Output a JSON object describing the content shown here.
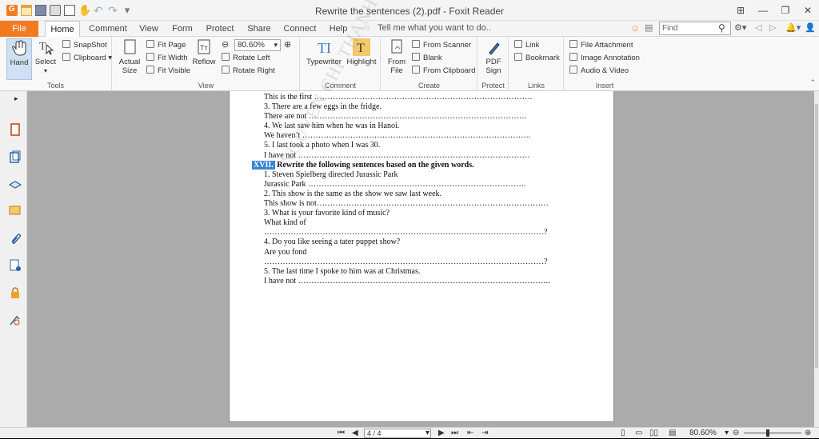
{
  "window": {
    "title": "Rewrite the sentences (2).pdf - Foxit Reader",
    "buttons": [
      "⊞",
      "—",
      "❐",
      "✕"
    ]
  },
  "menu": {
    "tabs": [
      "File",
      "Home",
      "Comment",
      "View",
      "Form",
      "Protect",
      "Share",
      "Connect",
      "Help"
    ],
    "tell_me": "Tell me what you want to do..",
    "search_placeholder": "Find"
  },
  "ribbon": {
    "tools": {
      "label": "Tools",
      "hand": "Hand",
      "select": "Select",
      "snapshot": "SnapShot",
      "clipboard": "Clipboard"
    },
    "view": {
      "label": "View",
      "actual_size": "Actual Size",
      "fit_page": "Fit Page",
      "fit_width": "Fit Width",
      "fit_visible": "Fit Visible",
      "reflow": "Reflow",
      "zoom_value": "80.60%",
      "rotate_left": "Rotate Left",
      "rotate_right": "Rotate Right"
    },
    "comment": {
      "label": "Comment",
      "typewriter": "Typewriter",
      "highlight": "Highlight"
    },
    "create": {
      "label": "Create",
      "from_file": "From File",
      "from_scanner": "From Scanner",
      "blank": "Blank",
      "from_clipboard": "From Clipboard"
    },
    "protect": {
      "label": "Protect",
      "pdf_sign": "PDF Sign"
    },
    "links": {
      "label": "Links",
      "link": "Link",
      "bookmark": "Bookmark"
    },
    "insert": {
      "label": "Insert",
      "file_attachment": "File Attachment",
      "image_annotation": "Image Annotation",
      "audio_video": "Audio & Video"
    }
  },
  "document": {
    "lines": [
      {
        "text": "This is the first ……………………………………………………………………….",
        "style": "ind"
      },
      {
        "text": "3. There are a few eggs in the fridge.",
        "style": "ind"
      },
      {
        "text": "There are not ……………………………………………………………………….",
        "style": "ind"
      },
      {
        "text": "4. We last saw him when he was in Hanoi.",
        "style": "ind"
      },
      {
        "text": "We haven’t …………………………………………………………………………..",
        "style": "ind"
      },
      {
        "text": "5. I last took a photo when I was 30.",
        "style": "ind"
      },
      {
        "text": "I have not ……………………………………………………………………………",
        "style": "ind"
      },
      {
        "text": "Rewrite the following sentences based on the given words.",
        "style": "head",
        "tag": "XVII."
      },
      {
        "text": "1. Steven Spielberg directed Jurassic Park",
        "style": "ind"
      },
      {
        "text": "Jurassic Park ……………………………………………………………………….",
        "style": "ind"
      },
      {
        "text": "2. This show is the same as the show we saw last week.",
        "style": "ind"
      },
      {
        "text": "This show is not……………………………………………………………………………",
        "style": "ind"
      },
      {
        "text": "3. What is your favorite kind of music?",
        "style": "ind"
      },
      {
        "text": "What kind of",
        "style": "ind"
      },
      {
        "text": "……………………………………………………………………………………………?",
        "style": "ind"
      },
      {
        "text": "4. Do you like seeing a tater puppet show?",
        "style": "ind"
      },
      {
        "text": "Are you fond",
        "style": "ind"
      },
      {
        "text": "……………………………………………………………………………………………?",
        "style": "ind"
      },
      {
        "text": "5. The last time I spoke to him was at Christmas.",
        "style": "ind"
      },
      {
        "text": "I have not …………………………………………………………………………………..",
        "style": "ind"
      }
    ],
    "watermark": "NGUYỄN CHÍ THANH · SECONDARY"
  },
  "status": {
    "page_indicator": "4 / 4",
    "zoom": "80.60%"
  }
}
